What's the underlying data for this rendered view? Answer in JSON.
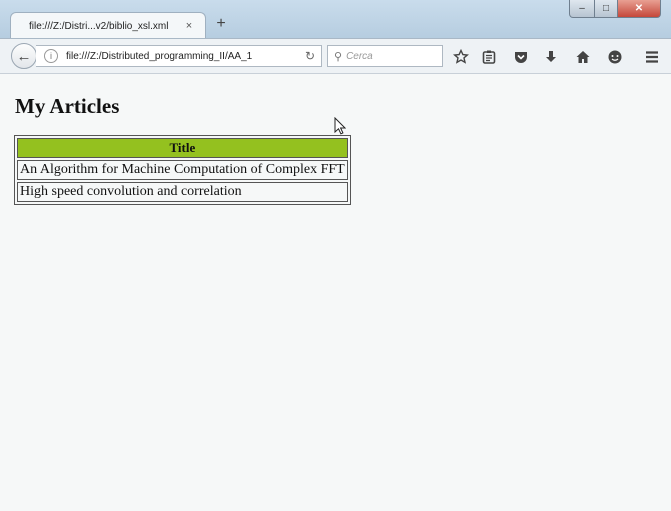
{
  "browser": {
    "tab": {
      "title": "file:///Z:/Distri...v2/biblio_xsl.xml",
      "close": "×"
    },
    "new_tab": "+",
    "window_controls": {
      "minimize": "–",
      "maximize": "□",
      "close": "✕"
    },
    "nav": {
      "back": "←",
      "url": "file:///Z:/Distributed_programming_II/AA_1",
      "reload": "↻",
      "search_placeholder": "Cerca",
      "search_glyph": "⚲"
    },
    "toolbar_icons": [
      "star-icon",
      "reading-list-icon",
      "pocket-icon",
      "download-icon",
      "home-icon",
      "chat-icon",
      "menu-icon"
    ]
  },
  "page": {
    "heading": "My Articles",
    "table": {
      "header": "Title",
      "header_color": "#94c11f",
      "rows": [
        "An Algorithm for Machine Computation of Complex FFT",
        "High speed convolution and correlation"
      ]
    }
  }
}
